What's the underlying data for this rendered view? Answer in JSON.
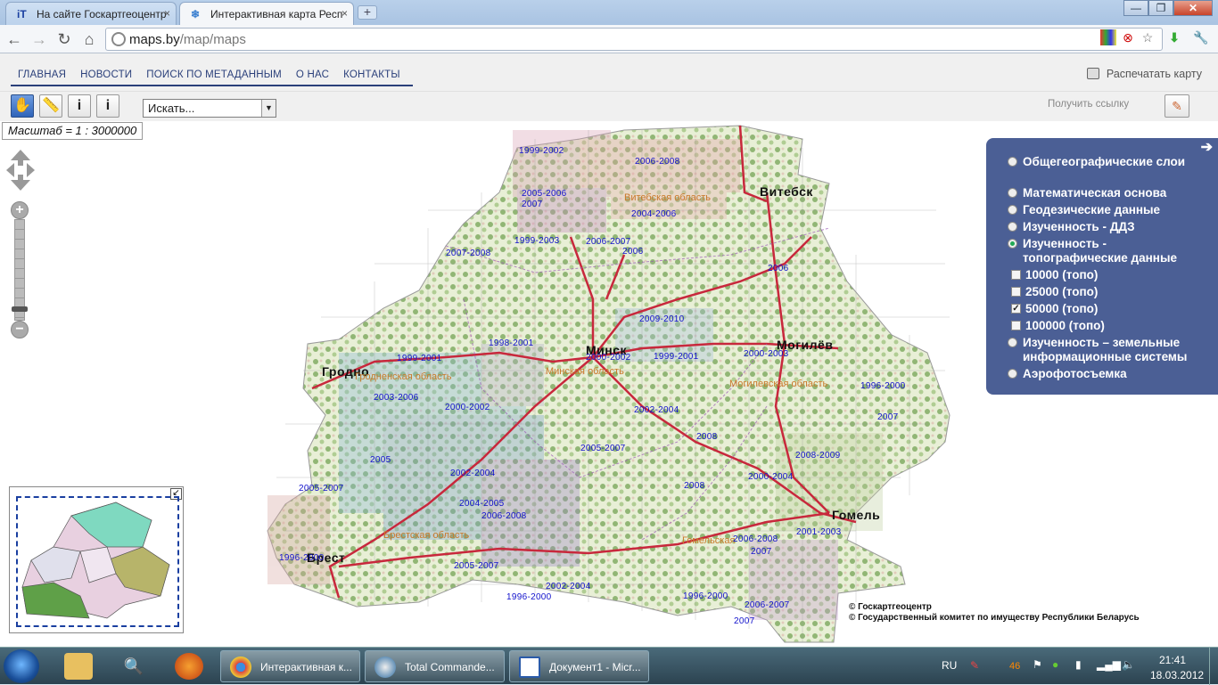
{
  "browser": {
    "tabs": [
      {
        "label": "На сайте Госкартгеоцентр",
        "close": "×"
      },
      {
        "label": "Интерактивная карта Респ",
        "close": "×"
      }
    ],
    "new_tab": "+",
    "url_host": "maps.by",
    "url_path": "/map/maps",
    "win_minimize": "—",
    "win_maximize": "❐",
    "win_close": "✕"
  },
  "site": {
    "menu": [
      "ГЛАВНАЯ",
      "НОВОСТИ",
      "ПОИСК ПО МЕТАДАННЫМ",
      "О НАС",
      "КОНТАКТЫ"
    ],
    "print_label": "Распечатать карту",
    "search_value": "Искать...",
    "get_link": "Получить ссылку"
  },
  "map": {
    "scale": "Масштаб = 1 : 3000000",
    "cities": [
      "Витебск",
      "Минск",
      "Могилёв",
      "Гродно",
      "Гомель",
      "Брест"
    ],
    "regions": [
      "Витебская область",
      "Минская область",
      "Гродненская область",
      "Могилевская область",
      "Брестская область",
      "Гомельская"
    ],
    "year_labels": [
      "1999-2002",
      "2006-2008",
      "2005-2006",
      "2007",
      "2004-2006",
      "1999-2003",
      "2006-2007",
      "2006",
      "2007-2008",
      "2006",
      "2009-2010",
      "1998-2001",
      "1999-2001",
      "2000-2002",
      "1999-2001",
      "2000-2003",
      "2003-2006",
      "2000-2002",
      "2002-2004",
      "1996-2000",
      "2007",
      "2008",
      "2005-2007",
      "2008-2009",
      "2005",
      "2002-2004",
      "2000-2004",
      "2008",
      "2005-2007",
      "2004-2005",
      "2006-2008",
      "2001-2003",
      "2006-2008",
      "2007",
      "1996-2000",
      "2005-2007",
      "2002-2004",
      "1996-2000",
      "1996-2000",
      "2006-2007",
      "2007"
    ],
    "copyright": [
      "© Госкартгеоцентр",
      "© Государственный комитет по имуществу Республики Беларусь"
    ]
  },
  "layers": {
    "items": [
      {
        "label": "Общегеографические слои",
        "type": "radio",
        "selected": false
      },
      {
        "label": "Математическая основа",
        "type": "radio",
        "selected": false
      },
      {
        "label": "Геодезические данные",
        "type": "radio",
        "selected": false
      },
      {
        "label": "Изученность - ДДЗ",
        "type": "radio",
        "selected": false
      },
      {
        "label": "Изученность - топографические данные",
        "type": "radio",
        "selected": true
      },
      {
        "label": "10000 (топо)",
        "type": "checkbox",
        "checked": false
      },
      {
        "label": "25000 (топо)",
        "type": "checkbox",
        "checked": false
      },
      {
        "label": "50000 (топо)",
        "type": "checkbox",
        "checked": true
      },
      {
        "label": "100000 (топо)",
        "type": "checkbox",
        "checked": false
      },
      {
        "label": "Изученность – земельные информационные системы",
        "type": "radio",
        "selected": false
      },
      {
        "label": "Аэрофотосъемка",
        "type": "radio",
        "selected": false
      }
    ]
  },
  "taskbar": {
    "tasks": [
      "Интерактивная к...",
      "Total Commande...",
      "Документ1 - Micr..."
    ],
    "lang": "RU",
    "badge": "46",
    "time": "21:41",
    "date": "18.03.2012"
  }
}
